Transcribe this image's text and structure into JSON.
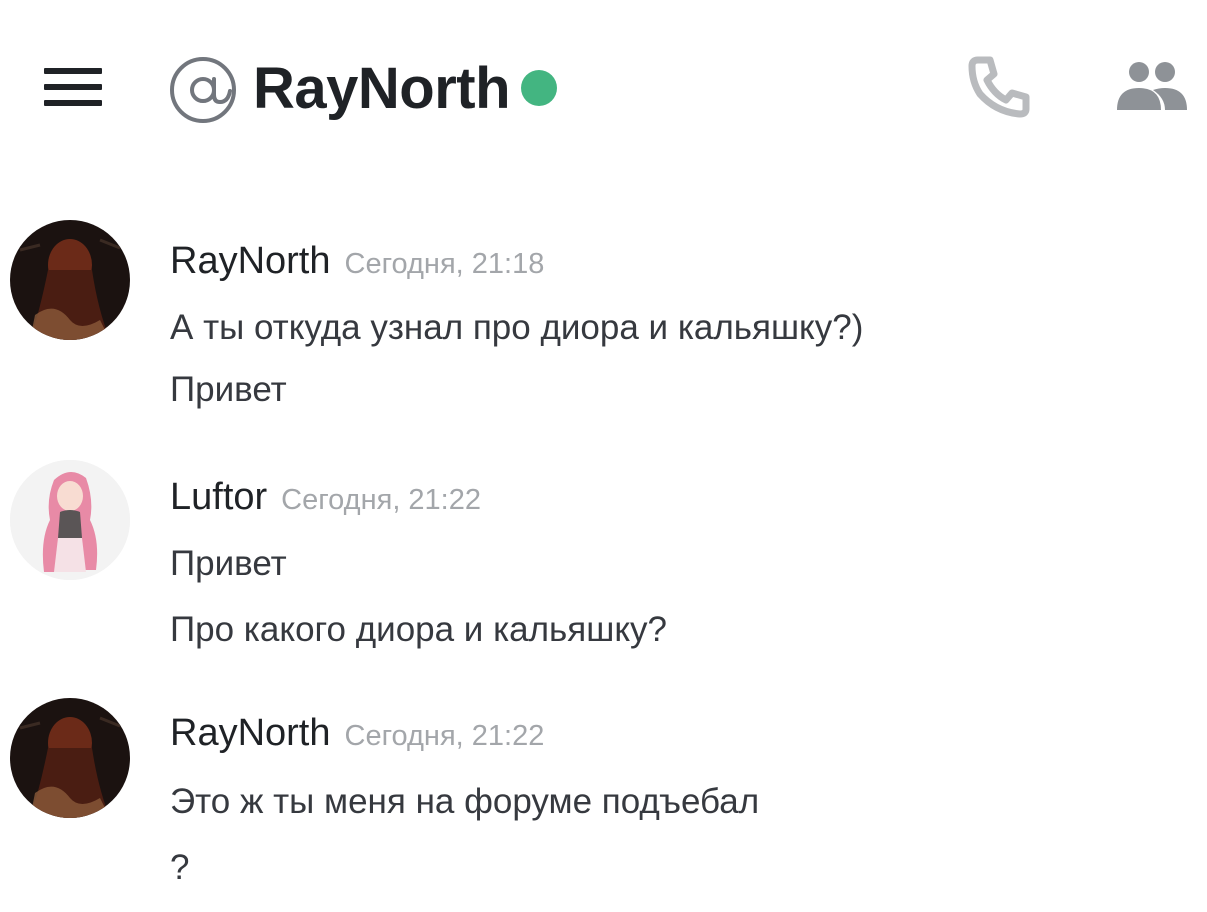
{
  "header": {
    "menu_icon": "hamburger-menu-icon",
    "at_icon": "at-sign-icon",
    "title": "RayNorth",
    "status": "online",
    "status_color": "#43b581",
    "call_icon": "phone-icon",
    "members_icon": "members-icon"
  },
  "messages": [
    {
      "author": "RayNorth",
      "timestamp": "Сегодня, 21:18",
      "avatar": "dark-portrait-avatar",
      "lines": [
        "А ты откуда узнал про диора и кальяшку?)",
        "Привет"
      ]
    },
    {
      "author": "Luftor",
      "timestamp": "Сегодня, 21:22",
      "avatar": "pink-anime-avatar",
      "lines": [
        "Привет",
        "Про какого диора и кальяшку?"
      ]
    },
    {
      "author": "RayNorth",
      "timestamp": "Сегодня, 21:22",
      "avatar": "dark-portrait-avatar",
      "lines": [
        "Это ж ты меня на форуме подъебал",
        "?"
      ]
    }
  ]
}
